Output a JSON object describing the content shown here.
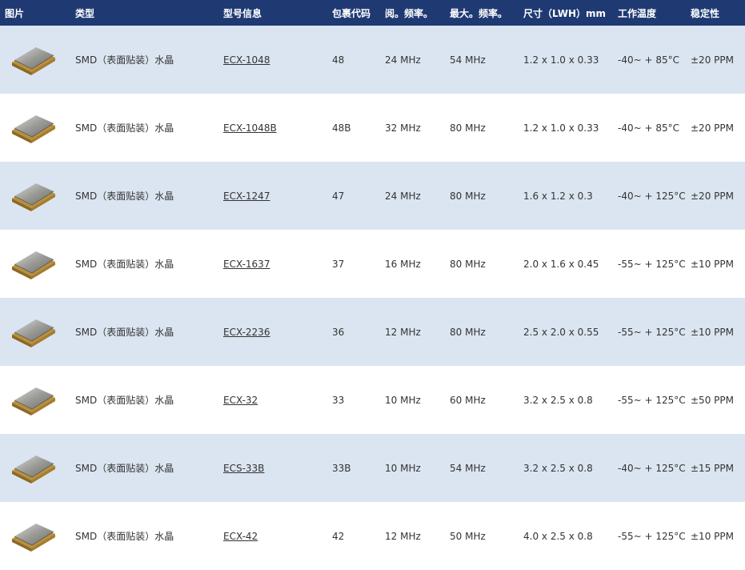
{
  "header": {
    "image": "图片",
    "type": "类型",
    "model": "型号信息",
    "package_code": "包裹代码",
    "min_freq": "阅。频率。",
    "max_freq": "最大。频率。",
    "size": "尺寸（LWH）mm",
    "temp": "工作温度",
    "stability": "稳定性"
  },
  "rows": [
    {
      "type": "SMD（表面贴装）水晶",
      "model": "ECX-1048",
      "package": "48",
      "min_freq": "24 MHz",
      "max_freq": "54 MHz",
      "size": "1.2 x 1.0 x 0.33",
      "temp": "-40~ + 85°C",
      "stability": "±20 PPM"
    },
    {
      "type": "SMD（表面贴装）水晶",
      "model": "ECX-1048B",
      "package": "48B",
      "min_freq": "32 MHz",
      "max_freq": "80 MHz",
      "size": "1.2 x 1.0 x 0.33",
      "temp": "-40~ + 85°C",
      "stability": "±20 PPM"
    },
    {
      "type": "SMD（表面贴装）水晶",
      "model": "ECX-1247",
      "package": "47",
      "min_freq": "24 MHz",
      "max_freq": "80 MHz",
      "size": "1.6 x 1.2 x 0.3",
      "temp": "-40~ + 125°C",
      "stability": "±20 PPM"
    },
    {
      "type": "SMD（表面贴装）水晶",
      "model": "ECX-1637",
      "package": "37",
      "min_freq": "16 MHz",
      "max_freq": "80 MHz",
      "size": "2.0 x 1.6 x 0.45",
      "temp": "-55~ + 125°C",
      "stability": "±10 PPM"
    },
    {
      "type": "SMD（表面贴装）水晶",
      "model": "ECX-2236",
      "package": "36",
      "min_freq": "12 MHz",
      "max_freq": "80 MHz",
      "size": "2.5 x 2.0 x 0.55",
      "temp": "-55~ + 125°C",
      "stability": "±10 PPM"
    },
    {
      "type": "SMD（表面贴装）水晶",
      "model": "ECX-32",
      "package": "33",
      "min_freq": "10 MHz",
      "max_freq": "60 MHz",
      "size": "3.2 x 2.5 x 0.8",
      "temp": "-55~ + 125°C",
      "stability": "±50 PPM"
    },
    {
      "type": "SMD（表面贴装）水晶",
      "model": "ECS-33B",
      "package": "33B",
      "min_freq": "10 MHz",
      "max_freq": "54 MHz",
      "size": "3.2 x 2.5 x 0.8",
      "temp": "-40~ + 125°C",
      "stability": "±15 PPM"
    },
    {
      "type": "SMD（表面贴装）水晶",
      "model": "ECX-42",
      "package": "42",
      "min_freq": "12 MHz",
      "max_freq": "50 MHz",
      "size": "4.0 x 2.5 x 0.8",
      "temp": "-55~ + 125°C",
      "stability": "±10 PPM"
    }
  ],
  "colors": {
    "header_bg": "#1f3a73",
    "row_shade": "#dbe5f1",
    "row_plain": "#ffffff"
  },
  "icons": {
    "row_image": "smd-crystal-icon"
  }
}
